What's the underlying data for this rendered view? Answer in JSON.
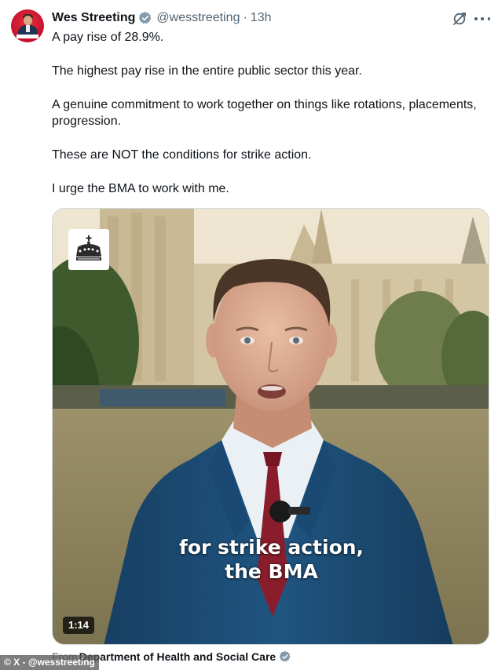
{
  "author": {
    "name": "Wes Streeting",
    "handle": "@wesstreeting",
    "separator": "·",
    "time": "13h",
    "avatar_icon": "profile-photo"
  },
  "actions": {
    "grok_icon": "grok-icon",
    "more_icon": "more-options-icon"
  },
  "tweet": {
    "paragraphs": [
      "A pay rise of 28.9%.",
      "The highest pay rise in the entire public sector this year.",
      "A genuine commitment to work together on things like rotations, placements, progression.",
      "These are NOT the conditions for strike action.",
      "I urge the BMA to work with me."
    ]
  },
  "video": {
    "caption_line1": "for strike action,",
    "caption_line2": "the BMA",
    "duration": "1:14",
    "logo_icon": "crown-logo"
  },
  "source": {
    "from_label": "From",
    "org_name": "Department of Health and Social Care"
  },
  "watermark": "© X - @wesstreeting",
  "colors": {
    "verified_blue": "#829aab",
    "muted_text": "#536471",
    "text": "#0f1419",
    "suit": "#1e4f78",
    "tie": "#8a1d2b"
  }
}
